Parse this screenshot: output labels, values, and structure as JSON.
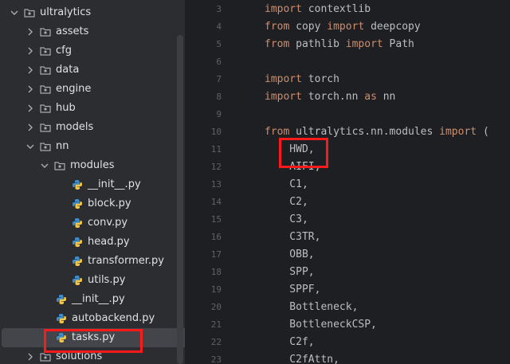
{
  "tree": {
    "items": [
      {
        "label": "ultralytics",
        "kind": "folder",
        "expanded": true
      },
      {
        "label": "assets",
        "kind": "folder",
        "expanded": false
      },
      {
        "label": "cfg",
        "kind": "folder",
        "expanded": false
      },
      {
        "label": "data",
        "kind": "folder",
        "expanded": false
      },
      {
        "label": "engine",
        "kind": "folder",
        "expanded": false
      },
      {
        "label": "hub",
        "kind": "folder",
        "expanded": false
      },
      {
        "label": "models",
        "kind": "folder",
        "expanded": false
      },
      {
        "label": "nn",
        "kind": "folder",
        "expanded": true
      },
      {
        "label": "modules",
        "kind": "folder",
        "expanded": true
      },
      {
        "label": "__init__.py",
        "kind": "python-file"
      },
      {
        "label": "block.py",
        "kind": "python-file"
      },
      {
        "label": "conv.py",
        "kind": "python-file"
      },
      {
        "label": "head.py",
        "kind": "python-file"
      },
      {
        "label": "transformer.py",
        "kind": "python-file"
      },
      {
        "label": "utils.py",
        "kind": "python-file"
      },
      {
        "label": "__init__.py",
        "kind": "python-file"
      },
      {
        "label": "autobackend.py",
        "kind": "python-file"
      },
      {
        "label": "tasks.py",
        "kind": "python-file",
        "selected": true
      },
      {
        "label": "solutions",
        "kind": "folder",
        "expanded": false
      }
    ]
  },
  "editor": {
    "lines": [
      {
        "n": "3",
        "kw1": "import",
        "t1": " contextlib",
        "kw2": "",
        "t2": ""
      },
      {
        "n": "4",
        "kw1": "from",
        "t1": " copy ",
        "kw2": "import",
        "t2": " deepcopy"
      },
      {
        "n": "5",
        "kw1": "from",
        "t1": " pathlib ",
        "kw2": "import",
        "t2": " Path"
      },
      {
        "n": "6",
        "kw1": "",
        "t1": "",
        "kw2": "",
        "t2": ""
      },
      {
        "n": "7",
        "kw1": "import",
        "t1": " torch",
        "kw2": "",
        "t2": ""
      },
      {
        "n": "8",
        "kw1": "import",
        "t1": " torch.nn ",
        "kw2": "as",
        "t2": " nn"
      },
      {
        "n": "9",
        "kw1": "",
        "t1": "",
        "kw2": "",
        "t2": ""
      },
      {
        "n": "10",
        "kw1": "from",
        "t1": " ultralytics.nn.modules ",
        "kw2": "import",
        "t2": " ("
      },
      {
        "n": "11",
        "kw1": "",
        "t1": "    HWD,",
        "kw2": "",
        "t2": ""
      },
      {
        "n": "12",
        "kw1": "",
        "t1": "    AIFI,",
        "kw2": "",
        "t2": ""
      },
      {
        "n": "13",
        "kw1": "",
        "t1": "    C1,",
        "kw2": "",
        "t2": ""
      },
      {
        "n": "14",
        "kw1": "",
        "t1": "    C2,",
        "kw2": "",
        "t2": ""
      },
      {
        "n": "15",
        "kw1": "",
        "t1": "    C3,",
        "kw2": "",
        "t2": ""
      },
      {
        "n": "16",
        "kw1": "",
        "t1": "    C3TR,",
        "kw2": "",
        "t2": ""
      },
      {
        "n": "17",
        "kw1": "",
        "t1": "    OBB,",
        "kw2": "",
        "t2": ""
      },
      {
        "n": "18",
        "kw1": "",
        "t1": "    SPP,",
        "kw2": "",
        "t2": ""
      },
      {
        "n": "19",
        "kw1": "",
        "t1": "    SPPF,",
        "kw2": "",
        "t2": ""
      },
      {
        "n": "20",
        "kw1": "",
        "t1": "    Bottleneck,",
        "kw2": "",
        "t2": ""
      },
      {
        "n": "21",
        "kw1": "",
        "t1": "    BottleneckCSP,",
        "kw2": "",
        "t2": ""
      },
      {
        "n": "22",
        "kw1": "",
        "t1": "    C2f,",
        "kw2": "",
        "t2": ""
      },
      {
        "n": "23",
        "kw1": "",
        "t1": "    C2fAttn,",
        "kw2": "",
        "t2": ""
      }
    ]
  },
  "colors": {
    "keyword": "#cf8e6d",
    "text": "#bcbec4",
    "highlight": "#ff1a1a"
  }
}
